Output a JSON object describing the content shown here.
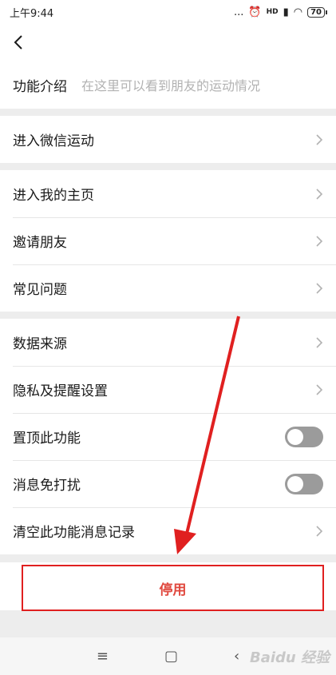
{
  "status": {
    "time": "上午9:44",
    "dots": "...",
    "network": "HD",
    "battery": "70"
  },
  "intro": {
    "label": "功能介绍",
    "desc": "在这里可以看到朋友的运动情况"
  },
  "group1": {
    "enter_sport": "进入微信运动"
  },
  "group2": {
    "homepage": "进入我的主页",
    "invite": "邀请朋友",
    "faq": "常见问题"
  },
  "group3": {
    "data_source": "数据来源",
    "privacy": "隐私及提醒设置",
    "pin_top": "置顶此功能",
    "mute": "消息免打扰",
    "clear": "清空此功能消息记录"
  },
  "toggles": {
    "pin_top_on": false,
    "mute_on": false
  },
  "disable_label": "停用",
  "bottom_nav": {
    "menu": "≡",
    "home": "▢",
    "back": "‹"
  },
  "watermark": "Baidu 经验",
  "colors": {
    "annotation_red": "#e02020",
    "toggle_off": "#9b9b9b"
  }
}
